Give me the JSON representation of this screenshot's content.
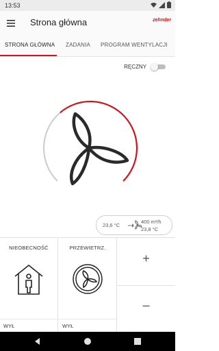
{
  "status_bar": {
    "time": "13:53"
  },
  "app_bar": {
    "title": "Strona główna",
    "brand": "zehnder"
  },
  "tabs": [
    {
      "label": "STRONA GŁÓWNA",
      "active": true
    },
    {
      "label": "ZADANIA",
      "active": false
    },
    {
      "label": "PROGRAM WENTYLACJI",
      "active": false
    }
  ],
  "manual_toggle": {
    "label": "RĘCZNY",
    "on": false
  },
  "fan_dial": {
    "level_fraction": 0.65,
    "accent_color": "#d0141b"
  },
  "info": {
    "indoor_temp": "23,6 °C",
    "airflow": "400 m³/h",
    "outdoor_temp": "23,8 °C"
  },
  "tiles": [
    {
      "label": "NIEOBECNOŚĆ",
      "status": "WYŁ",
      "icon": "house-person-icon"
    },
    {
      "label": "PRZEWIETRZ.",
      "status": "WYŁ",
      "icon": "fan-icon"
    }
  ],
  "stepper": {
    "plus": "+",
    "minus": "–"
  }
}
